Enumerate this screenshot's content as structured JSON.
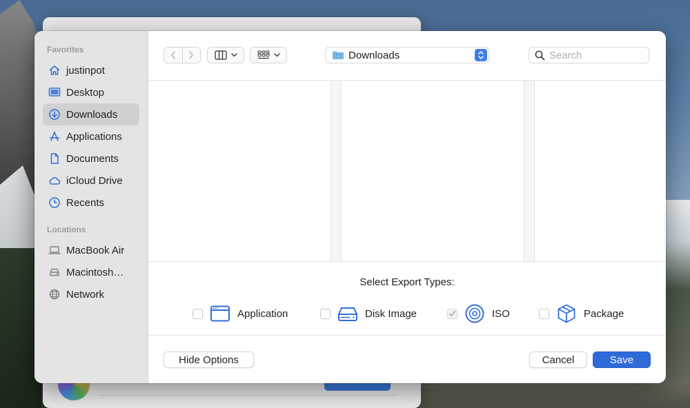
{
  "sidebar": {
    "favorites_heading": "Favorites",
    "favorites": [
      {
        "label": "justinpot",
        "icon": "home-icon"
      },
      {
        "label": "Desktop",
        "icon": "desktop-icon"
      },
      {
        "label": "Downloads",
        "icon": "downloads-icon",
        "selected": true
      },
      {
        "label": "Applications",
        "icon": "applications-icon"
      },
      {
        "label": "Documents",
        "icon": "document-icon"
      },
      {
        "label": "iCloud Drive",
        "icon": "cloud-icon"
      },
      {
        "label": "Recents",
        "icon": "clock-icon"
      }
    ],
    "locations_heading": "Locations",
    "locations": [
      {
        "label": "MacBook Air",
        "icon": "laptop-icon"
      },
      {
        "label": "Macintosh…",
        "icon": "disk-icon"
      },
      {
        "label": "Network",
        "icon": "globe-icon"
      }
    ]
  },
  "toolbar": {
    "current_folder": "Downloads",
    "search_placeholder": "Search"
  },
  "options": {
    "heading": "Select Export Types:",
    "types": [
      {
        "label": "Application",
        "checked": false,
        "icon": "application-window-icon"
      },
      {
        "label": "Disk Image",
        "checked": false,
        "icon": "disk-image-icon"
      },
      {
        "label": "ISO",
        "checked": true,
        "icon": "iso-disc-icon"
      },
      {
        "label": "Package",
        "checked": false,
        "icon": "package-box-icon"
      }
    ]
  },
  "footer": {
    "hide_options_label": "Hide Options",
    "cancel_label": "Cancel",
    "save_label": "Save"
  },
  "colors": {
    "accent": "#2f6ad9",
    "icon_blue": "#2f6fd6",
    "sidebar_bg": "#e4e4e4"
  }
}
